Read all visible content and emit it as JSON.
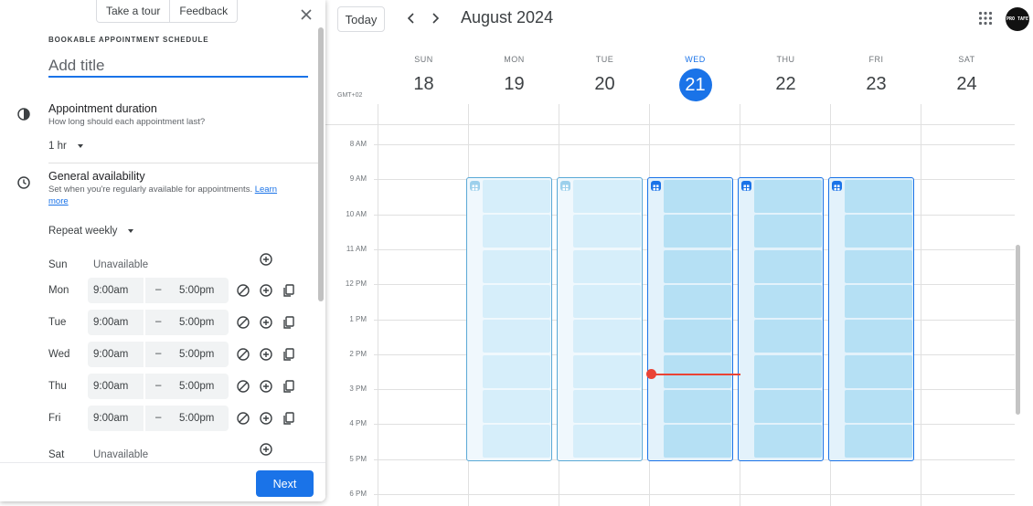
{
  "calendar": {
    "today_label": "Today",
    "month_label": "August 2024",
    "timezone": "GMT+02",
    "avatar_text": "PRO TAFE",
    "days": [
      {
        "name": "SUN",
        "num": "18"
      },
      {
        "name": "MON",
        "num": "19"
      },
      {
        "name": "TUE",
        "num": "20"
      },
      {
        "name": "WED",
        "num": "21"
      },
      {
        "name": "THU",
        "num": "22"
      },
      {
        "name": "FRI",
        "num": "23"
      },
      {
        "name": "SAT",
        "num": "24"
      }
    ],
    "hours": [
      "8 AM",
      "9 AM",
      "10 AM",
      "11 AM",
      "12 PM",
      "1 PM",
      "2 PM",
      "3 PM",
      "4 PM",
      "5 PM",
      "6 PM"
    ]
  },
  "panel": {
    "tour_label": "Take a tour",
    "feedback_label": "Feedback",
    "schedule_label": "BOOKABLE APPOINTMENT SCHEDULE",
    "title_placeholder": "Add title",
    "duration": {
      "title": "Appointment duration",
      "subtitle": "How long should each appointment last?",
      "value": "1 hr"
    },
    "availability": {
      "title": "General availability",
      "subtitle": "Set when you're regularly available for appointments.",
      "learn_more": "Learn more",
      "repeat": "Repeat weekly"
    },
    "dash": "–",
    "unavailable_label": "Unavailable",
    "rows": [
      {
        "day": "Sun",
        "start": "",
        "end": ""
      },
      {
        "day": "Mon",
        "start": "9:00am",
        "end": "5:00pm"
      },
      {
        "day": "Tue",
        "start": "9:00am",
        "end": "5:00pm"
      },
      {
        "day": "Wed",
        "start": "9:00am",
        "end": "5:00pm"
      },
      {
        "day": "Thu",
        "start": "9:00am",
        "end": "5:00pm"
      },
      {
        "day": "Fri",
        "start": "9:00am",
        "end": "5:00pm"
      },
      {
        "day": "Sat",
        "start": "",
        "end": ""
      }
    ],
    "next_label": "Next"
  },
  "colors": {
    "accent": "#1a73e8",
    "now_indicator": "#ea4335",
    "slot_fill": "#b5e0f4"
  }
}
